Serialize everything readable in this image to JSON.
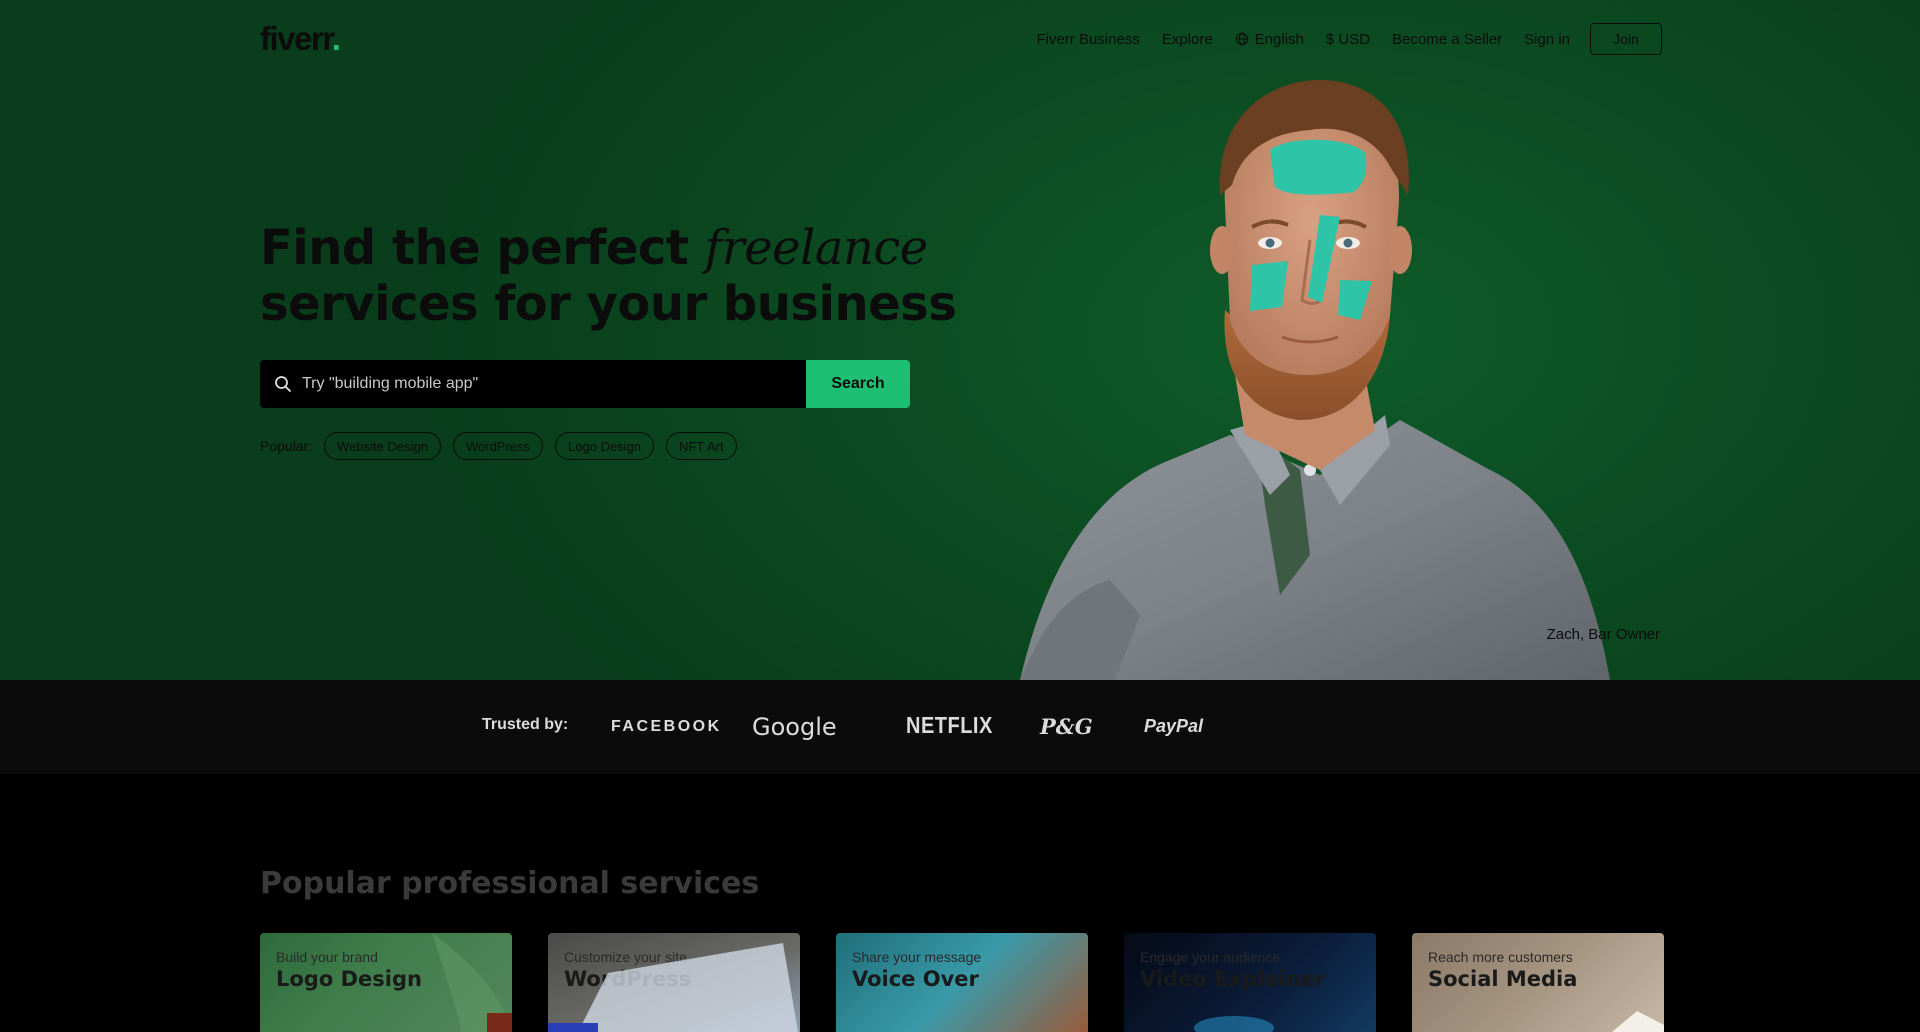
{
  "header": {
    "logo_text": "fiverr",
    "logo_dot": ".",
    "nav": {
      "business": "Fiverr Business",
      "explore": "Explore",
      "language": "English",
      "currency": "$ USD",
      "become_seller": "Become a Seller",
      "sign_in": "Sign in",
      "join": "Join"
    }
  },
  "hero": {
    "headline_part1": "Find the perfect ",
    "headline_accent": "freelance",
    "headline_part2": "services for your business",
    "search": {
      "placeholder": "Try \"building mobile app\"",
      "button": "Search"
    },
    "popular": {
      "label": "Popular:",
      "chips": [
        "Website Design",
        "WordPress",
        "Logo Design",
        "NFT Art"
      ]
    },
    "caption": "Zach, Bar Owner"
  },
  "trusted": {
    "label": "Trusted by:",
    "brands": [
      "FACEBOOK",
      "Google",
      "NETFLIX",
      "P&G",
      "PayPal"
    ]
  },
  "services": {
    "title": "Popular professional services",
    "cards": [
      {
        "subtitle": "Build your brand",
        "title": "Logo Design"
      },
      {
        "subtitle": "Customize your site",
        "title": "WordPress"
      },
      {
        "subtitle": "Share your message",
        "title": "Voice Over"
      },
      {
        "subtitle": "Engage your audience",
        "title": "Video Explainer"
      },
      {
        "subtitle": "Reach more customers",
        "title": "Social Media"
      }
    ]
  },
  "colors": {
    "hero_green": "#0c4d22",
    "brand_green": "#1dbf73",
    "trusted_bg": "#0b0b0b"
  }
}
